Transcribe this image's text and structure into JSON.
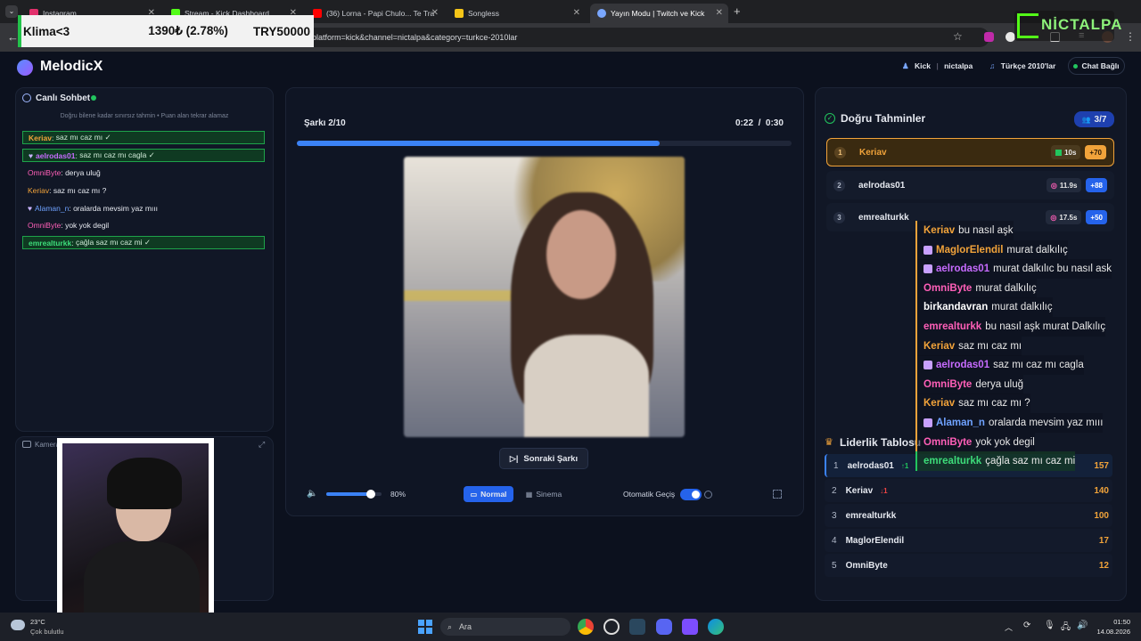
{
  "browser": {
    "tabs": [
      {
        "label": "Instagram",
        "color": "#e1306c"
      },
      {
        "label": "Stream - Kick Dashboard",
        "color": "#53fc18"
      },
      {
        "label": "(36) Lorna - Papi Chulo... Te Tra",
        "color": "#ff0000"
      },
      {
        "label": "Songless",
        "color": "#f5c518"
      },
      {
        "label": "Yayın Modu | Twitch ve Kick",
        "color": "#7aa7ff"
      }
    ],
    "url": "platform=kick&channel=nictalpa&category=turkce-2010lar"
  },
  "ticker": {
    "left": "Klima<3",
    "mid": "1390₺ (2.78%)",
    "right": "TRY50000"
  },
  "watermark": "NİCTALPA",
  "app": {
    "name": "MelodicX",
    "header": {
      "platform": "Kick",
      "channel": "nictalpa",
      "category": "Türkçe 2010'lar",
      "chat_status": "Chat Bağlı"
    }
  },
  "chat": {
    "title": "Canlı Sohbet",
    "hint": "Doğru bilene kadar sınırsız tahmin • Puan alan tekrar alamaz",
    "messages": [
      {
        "user": "Keriav",
        "text": "saz mı caz mı ✓",
        "color": "#f2a33a",
        "correct": true
      },
      {
        "user": "aelrodas01",
        "text": "saz mı caz mı cagla ✓",
        "color": "#c76bff",
        "correct": true
      },
      {
        "user": "OmniByte",
        "text": "derya uluğ",
        "color": "#ff5fb8",
        "correct": false
      },
      {
        "user": "Keriav",
        "text": "saz mı caz mı ?",
        "color": "#f2a33a",
        "correct": false
      },
      {
        "user": "Alaman_n",
        "text": "oralarda mevsim yaz mııı",
        "color": "#6fa2ff",
        "correct": false
      },
      {
        "user": "OmniByte",
        "text": "yok yok degil",
        "color": "#ff5fb8",
        "correct": false
      },
      {
        "user": "emrealturkk",
        "text": "çağla saz mı caz mi ✓",
        "color": "#3ddc7a",
        "correct": true
      }
    ],
    "camera_label": "Kamera"
  },
  "player": {
    "song_label": "Şarkı 2/10",
    "time": "0:22  /  0:30",
    "progress": 0.733,
    "next_button": "Sonraki Şarkı",
    "volume_value": 0.8,
    "volume_text": "80%",
    "mode_normal": "Normal",
    "mode_cinema": "Sinema",
    "auto_label": "Otomatik Geçiş"
  },
  "predictions": {
    "title": "Doğru Tahminler",
    "count": "3/7",
    "rows": [
      {
        "rank": "1",
        "name": "Keriav",
        "time": "10s",
        "points": "+70"
      },
      {
        "rank": "2",
        "name": "aelrodas01",
        "time": "11.9s",
        "points": "+88"
      },
      {
        "rank": "3",
        "name": "emrealturkk",
        "time": "17.5s",
        "points": "+50"
      }
    ]
  },
  "leaderboard": {
    "title": "Liderlik Tablosu",
    "rows": [
      {
        "rank": "1",
        "name": "aelrodas01",
        "change": "↑1",
        "score": "157"
      },
      {
        "rank": "2",
        "name": "Keriav",
        "change": "↓1",
        "score": "140"
      },
      {
        "rank": "3",
        "name": "emrealturkk",
        "change": "",
        "score": "100"
      },
      {
        "rank": "4",
        "name": "MaglorElendil",
        "change": "",
        "score": "17"
      },
      {
        "rank": "5",
        "name": "OmniByte",
        "change": "",
        "score": "12"
      }
    ]
  },
  "overlay_chat": [
    {
      "user": "Keriav",
      "text": "bu nasıl aşk",
      "color": "#f2a33a",
      "badge": false,
      "highlight": false
    },
    {
      "user": "MaglorElendil",
      "text": "murat dalkılıç",
      "color": "#f2a33a",
      "badge": true,
      "highlight": false
    },
    {
      "user": "aelrodas01",
      "text": "murat dalkılıc bu nasıl ask",
      "color": "#c76bff",
      "badge": true,
      "highlight": false
    },
    {
      "user": "OmniByte",
      "text": "murat dalkılıç",
      "color": "#ff5fb8",
      "badge": false,
      "highlight": false
    },
    {
      "user": "birkandavran",
      "text": "murat dalkılıç",
      "color": "#ffffff",
      "badge": false,
      "highlight": false
    },
    {
      "user": "emrealturkk",
      "text": "bu nasıl aşk murat Dalkılıç",
      "color": "#ff5fb8",
      "badge": false,
      "highlight": false
    },
    {
      "user": "Keriav",
      "text": "saz mı caz mı",
      "color": "#f2a33a",
      "badge": false,
      "highlight": false
    },
    {
      "user": "aelrodas01",
      "text": "saz mı caz mı cagla",
      "color": "#c76bff",
      "badge": true,
      "highlight": false
    },
    {
      "user": "OmniByte",
      "text": "derya uluğ",
      "color": "#ff5fb8",
      "badge": false,
      "highlight": false
    },
    {
      "user": "Keriav",
      "text": "saz mı caz mı ?",
      "color": "#f2a33a",
      "badge": false,
      "highlight": false
    },
    {
      "user": "Alaman_n",
      "text": "oralarda mevsim yaz mııı",
      "color": "#6fa2ff",
      "badge": true,
      "highlight": false
    },
    {
      "user": "OmniByte",
      "text": "yok yok degil",
      "color": "#ff5fb8",
      "badge": false,
      "highlight": false
    },
    {
      "user": "emrealturkk",
      "text": "çağla saz mı caz mi",
      "color": "#3ddc7a",
      "badge": false,
      "highlight": true
    }
  ],
  "taskbar": {
    "weather_temp": "23°C",
    "weather_desc": "Çok bulutlu",
    "search": "Ara",
    "time": "01:50",
    "date": "14.08.2026"
  },
  "colors": {
    "accent": "#3b82f6",
    "gold": "#f1a33a",
    "green": "#22c55e"
  }
}
